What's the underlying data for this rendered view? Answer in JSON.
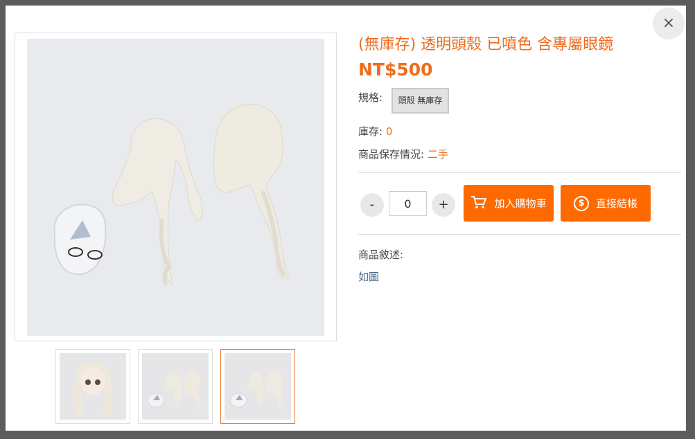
{
  "product": {
    "title": "(無庫存) 透明頭殼 已噴色 含專屬眼鏡",
    "price": "NT$500",
    "spec_label": "規格:",
    "spec_option": "頭殼 無庫存",
    "stock_label": "庫存: ",
    "stock_value": "0",
    "condition_label": "商品保存情況: ",
    "condition_value": "二手",
    "description_label": "商品敘述:",
    "description_text": "如圖"
  },
  "purchase": {
    "minus": "-",
    "plus": "+",
    "quantity": "0",
    "add_to_cart": "加入購物車",
    "checkout": "直接結帳"
  },
  "modal": {
    "close": "×"
  },
  "gallery": {
    "thumbnail_count": 3,
    "active_thumbnail": 3
  },
  "colors": {
    "accent": "#ff6a00",
    "title": "#ef6c1c"
  }
}
